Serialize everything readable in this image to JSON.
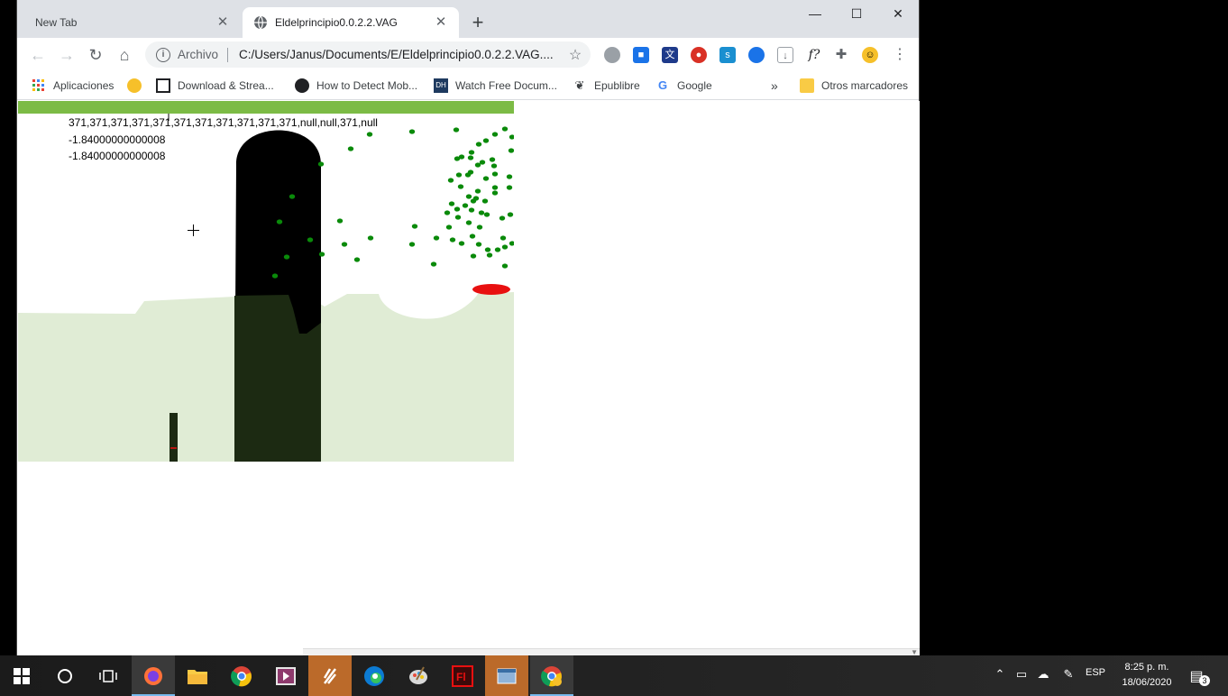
{
  "tabs": [
    {
      "label": "New Tab"
    },
    {
      "label": "Eldelprincipio0.0.2.2.VAG"
    }
  ],
  "toolbar": {
    "chip": "Archivo",
    "url": "C:/Users/Janus/Documents/E/Eldelprincipio0.0.2.2.VAG...."
  },
  "bookmarks": [
    {
      "label": "Aplicaciones",
      "icon": "apps-grid-icon"
    },
    {
      "label": "",
      "icon": "smiley-icon"
    },
    {
      "label": "Download & Strea...",
      "icon": "archive-icon"
    },
    {
      "label": "How to Detect Mob...",
      "icon": "mob-icon"
    },
    {
      "label": "Watch Free Docum...",
      "icon": "dh-icon"
    },
    {
      "label": "Epublibre",
      "icon": "epublibre-icon"
    },
    {
      "label": "Google",
      "icon": "google-icon"
    }
  ],
  "bookmarks_other": "Otros marcadores",
  "page": {
    "debug_line1": "371,371,371,371,371,371,371,371,371,371,371,null,null,371,null",
    "debug_line2": "-1.84000000000008",
    "debug_line3": "-1.84000000000008"
  },
  "taskbar": {
    "lang": "ESP",
    "time": "8:25 p. m.",
    "date": "18/06/2020",
    "notifications": "3"
  },
  "colors": {
    "top_bar": "#7cbb45",
    "ground": "#e0ecd5",
    "tree_trunk": "#000000",
    "trunk_shadow": "#1c2a12",
    "leaves": "#0a8a0a",
    "red_object": "#e81010"
  }
}
